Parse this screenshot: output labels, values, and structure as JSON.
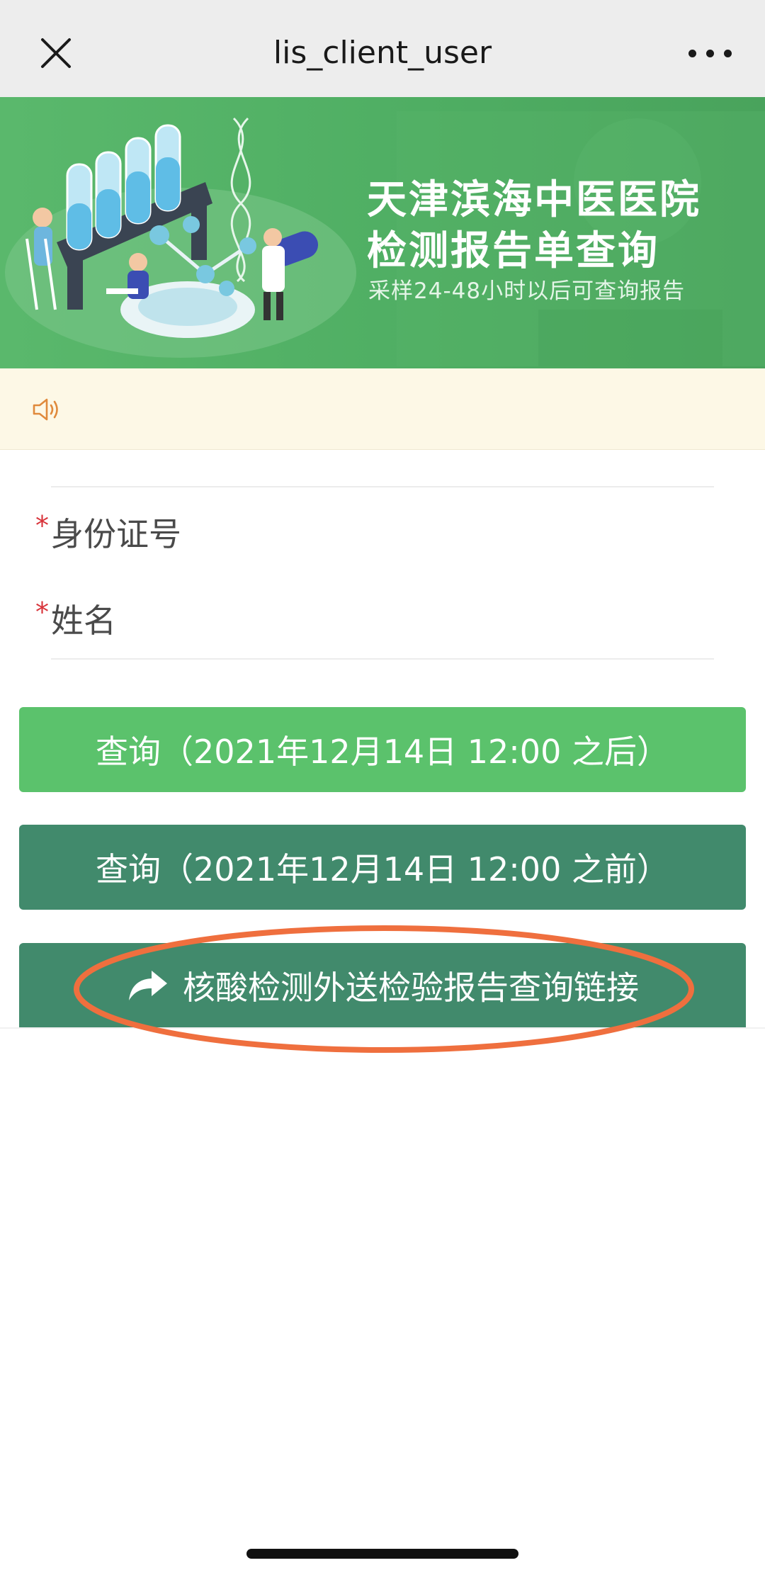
{
  "titlebar": {
    "title": "lis_client_user",
    "close_icon": "close-icon",
    "more_icon": "more-icon"
  },
  "banner": {
    "title_line1": "天津滨海中医医院",
    "title_line2": "检测报告单查询",
    "subtitle": "采样24-48小时以后可查询报告",
    "colors": {
      "green": "#52b064",
      "text": "#ffffff"
    }
  },
  "notice": {
    "icon": "speaker-icon",
    "text": ""
  },
  "form": {
    "required_mark": "*",
    "id_label": "身份证号",
    "id_value": "",
    "name_label": "姓名",
    "name_value": ""
  },
  "buttons": {
    "query_after": "查询（2021年12月14日 12:00 之后）",
    "query_before": "查询（2021年12月14日 12:00 之前）",
    "external_link": "核酸检测外送检验报告查询链接",
    "external_link_icon": "share-arrow-icon"
  },
  "colors": {
    "button_light_green": "#5bc26c",
    "button_dark_green": "#418a6c",
    "required_red": "#d8333a",
    "annotation_orange": "#ef6f3e",
    "notice_bg": "#fdf8e6"
  }
}
